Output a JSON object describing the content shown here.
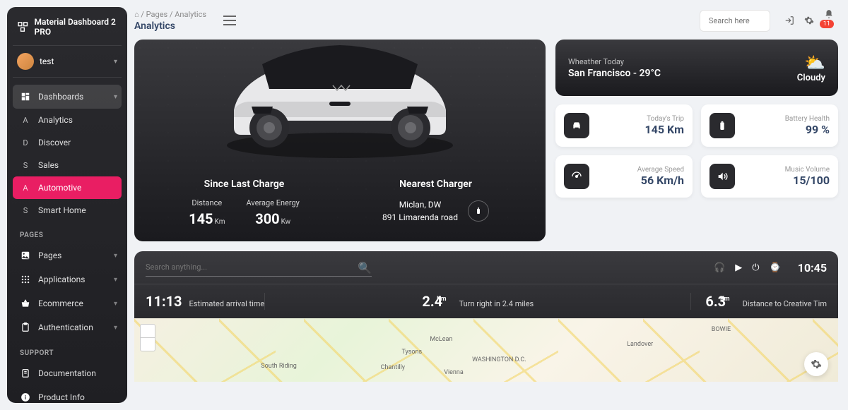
{
  "app_title": "Material Dashboard 2 PRO",
  "user": {
    "name": "test"
  },
  "nav": {
    "dashboards": "Dashboards",
    "items": [
      "Analytics",
      "Discover",
      "Sales",
      "Automotive",
      "Smart Home"
    ],
    "letters": [
      "A",
      "D",
      "S",
      "A",
      "S"
    ],
    "pages_label": "PAGES",
    "pages": [
      "Pages",
      "Applications",
      "Ecommerce",
      "Authentication"
    ],
    "support_label": "SUPPORT",
    "support": [
      "Documentation",
      "Product Info"
    ]
  },
  "breadcrumb": {
    "root": "⌂",
    "path": "Pages",
    "current": "Analytics",
    "title": "Analytics"
  },
  "search_placeholder": "Search here",
  "notif_count": "11",
  "car": {
    "since_title": "Since Last Charge",
    "distance_label": "Distance",
    "distance_val": "145",
    "distance_unit": "Km",
    "energy_label": "Average Energy",
    "energy_val": "300",
    "energy_unit": "Kw",
    "charger_title": "Nearest Charger",
    "charger_loc1": "Miclan, DW",
    "charger_loc2": "891 Limarenda road"
  },
  "weather": {
    "label": "Wheather Today",
    "location": "San Francisco - 29°C",
    "desc": "Cloudy"
  },
  "cards": [
    {
      "label": "Today's Trip",
      "value": "145 Km"
    },
    {
      "label": "Battery Health",
      "value": "99 %"
    },
    {
      "label": "Average Speed",
      "value": "56 Km/h"
    },
    {
      "label": "Music Volume",
      "value": "15/100"
    }
  ],
  "navbar": {
    "search_placeholder": "Search anything...",
    "time": "10:45",
    "s1_val": "11:13",
    "s1_desc": "Estimated arrival time",
    "s2_val": "2.4",
    "s2_unit": "Km",
    "s2_desc": "Turn right in 2.4 miles",
    "s3_val": "6.3",
    "s3_unit": "Km",
    "s3_desc": "Distance to Creative Tim"
  },
  "map_city": "WASHINGTON D.C."
}
